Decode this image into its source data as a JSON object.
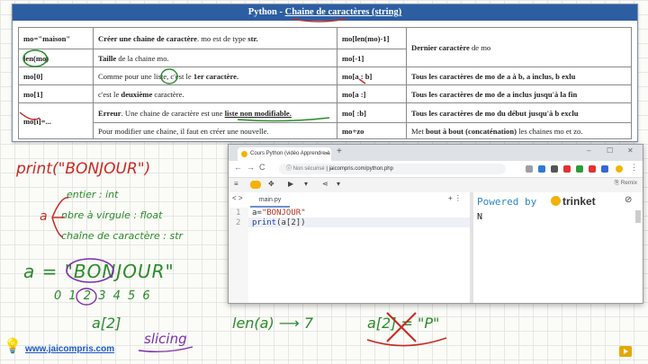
{
  "reference": {
    "title_a": "Python -",
    "title_b": "Chaine de caractères (string)",
    "rows": [
      {
        "c1": "mo=\"maison\"",
        "c2a": "Créer une chaine de caractère",
        "c2b": ". mo est de type ",
        "c2c": "str.",
        "c3": "mo[len(mo)-1]",
        "c4a": "Dernier caractère",
        "c4b": " de mo"
      },
      {
        "c1": "len(mo)",
        "c2a": "Taille",
        "c2b": " de la chaine mo.",
        "c2c": "",
        "c3": "mo[-1]",
        "c4a": "",
        "c4b": ""
      },
      {
        "c1": "mo[0]",
        "c2a": "Comme pour une liste, c'est le ",
        "c2b": "1er caractère.",
        "c2c": "",
        "c3": "mo[a : b]",
        "c4a": "Tous les caractères de mo de a à b, a inclus, b exlu",
        "c4b": ""
      },
      {
        "c1": "mo[1]",
        "c2a": "c'est le ",
        "c2b": "deuxième",
        "c2c": " caractère.",
        "c3": "mo[a :]",
        "c4a": "Tous les caractères de mo de a inclus jusqu'à la fin",
        "c4b": ""
      },
      {
        "c1": "mo[i]=...",
        "c2a": "Erreur",
        "c2b": ". Une chaine de caractère est une ",
        "c2c": "liste non modifiable.",
        "c3": "mo[ :b]",
        "c4a": "Tous les caractères de mo du début jusqu'à b exclu",
        "c4b": ""
      },
      {
        "c1": "",
        "c2a": "Pour modifier une chaine, il faut en créer une nouvelle.",
        "c2b": "",
        "c2c": "",
        "c3": "mo+zo",
        "c4a": "Met ",
        "c4b": "bout à bout (concaténation)",
        "c4c": " les chaines mo et zo."
      }
    ]
  },
  "browser": {
    "tab_title": "Cours Python (vidéo Apprendre à",
    "tab_close": "×",
    "new_tab": "+",
    "win_min": "–",
    "win_max": "☐",
    "win_close": "✕",
    "back": "←",
    "forward": "→",
    "reload": "C",
    "home": "⌂",
    "url_security": "Non sécurisé",
    "url": "jaicompris.com/python.php",
    "remix": "Remix",
    "file_tab": "main.py",
    "code_lines": [
      {
        "n": "1",
        "a": "a=",
        "b": "\"BONJOUR\"",
        "c": ""
      },
      {
        "n": "2",
        "a": "print",
        "b": "(a[2])",
        "c": ""
      }
    ],
    "powered_by": "Powered by",
    "logo": "trinket",
    "output": "N"
  },
  "notes": {
    "print_bonjour": "print(\"BONJOUR\")",
    "entier": "entier : int",
    "virgule": "nbre à virgule : float",
    "chaine": "chaîne de caractère : str",
    "a_label": "a",
    "assign": "a = \"BONJOUR\"",
    "indices": "0 1 2 3 4 5 6",
    "a2": "a[2]",
    "slicing": "slicing",
    "len": "len(a) ⟶ 7",
    "wrong": "a[2] = \"P\"",
    "website": "www.jaicompris.com"
  },
  "colors": {
    "header": "#2d5ea2",
    "red_ink": "#c62a23",
    "green_ink": "#2b8a2b",
    "purple_ink": "#7a2fa6",
    "link": "#1b57c6"
  }
}
